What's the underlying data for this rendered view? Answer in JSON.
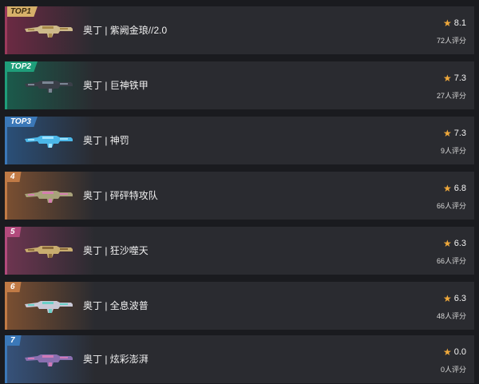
{
  "items": [
    {
      "rank_label": "TOP1",
      "name": "奥丁 | 紫阙金琅//2.0",
      "score": "8.1",
      "ratings": "72人评分",
      "accent": "#9b3a5c",
      "grad": "#6b2a43",
      "gun_color": "#cdb98a",
      "gun_accent": "#a88a4a",
      "icon": "odin-golden-icon"
    },
    {
      "rank_label": "TOP2",
      "name": "奥丁 | 巨神铁甲",
      "score": "7.3",
      "ratings": "27人评分",
      "accent": "#1f9e7a",
      "grad": "#1b5a4b",
      "gun_color": "#3a3f48",
      "gun_accent": "#7b8694",
      "icon": "odin-titan-icon"
    },
    {
      "rank_label": "TOP3",
      "name": "奥丁 | 神罚",
      "score": "7.3",
      "ratings": "9人评分",
      "accent": "#3b78b8",
      "grad": "#2a4f78",
      "gun_color": "#4bb7e8",
      "gun_accent": "#9fe3ff",
      "icon": "odin-divine-icon"
    },
    {
      "rank_label": "4",
      "name": "奥丁 | 砰砰特攻队",
      "score": "6.8",
      "ratings": "66人评分",
      "accent": "#c07a45",
      "grad": "#7a4f31",
      "gun_color": "#a8a27a",
      "gun_accent": "#d47fb0",
      "icon": "odin-boom-icon"
    },
    {
      "rank_label": "5",
      "name": "奥丁 | 狂沙噬天",
      "score": "6.3",
      "ratings": "66人评分",
      "accent": "#b24a7c",
      "grad": "#6d3550",
      "gun_color": "#c9ad6f",
      "gun_accent": "#8b6a3a",
      "icon": "odin-sand-icon"
    },
    {
      "rank_label": "6",
      "name": "奥丁 | 全息波普",
      "score": "6.3",
      "ratings": "48人评分",
      "accent": "#c07a45",
      "grad": "#7a4f31",
      "gun_color": "#c9c9d6",
      "gun_accent": "#6ad0c8",
      "icon": "odin-holo-icon"
    },
    {
      "rank_label": "7",
      "name": "奥丁 | 炫彩澎湃",
      "score": "0.0",
      "ratings": "0人评分",
      "accent": "#3b78b8",
      "grad": "#36527a",
      "gun_color": "#8a6fb0",
      "gun_accent": "#d07ab8",
      "icon": "odin-rainbow-icon"
    }
  ]
}
